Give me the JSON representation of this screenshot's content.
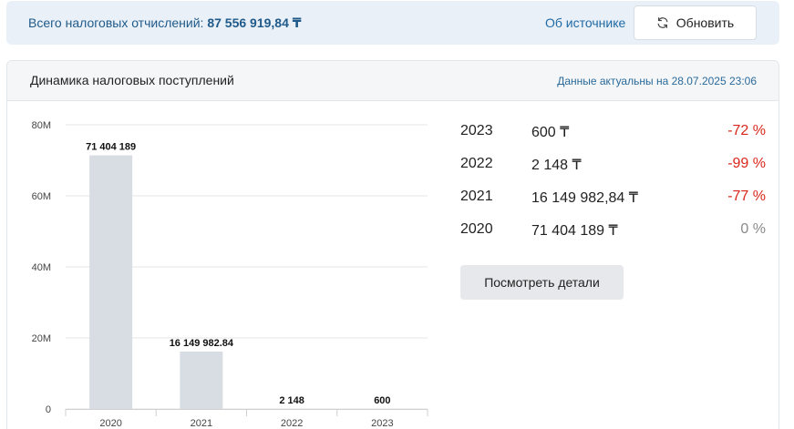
{
  "header": {
    "total_label": "Всего налоговых отчислений:",
    "total_value": "87 556 919,84 ₸",
    "source_link": "Об источнике",
    "refresh_label": "Обновить",
    "refresh_icon": "refresh-icon"
  },
  "panel": {
    "title": "Динамика налоговых поступлений",
    "updated": "Данные актуальны на 28.07.2025 23:06"
  },
  "stats": [
    {
      "year": "2023",
      "amount": "600 ₸",
      "change": "-72 %",
      "status": "negative"
    },
    {
      "year": "2022",
      "amount": "2 148 ₸",
      "change": "-99 %",
      "status": "negative"
    },
    {
      "year": "2021",
      "amount": "16 149 982,84 ₸",
      "change": "-77 %",
      "status": "negative"
    },
    {
      "year": "2020",
      "amount": "71 404 189 ₸",
      "change": "0 %",
      "status": "neutral"
    }
  ],
  "details_button": "Посмотреть детали",
  "colors": {
    "bar": "#d8dce3",
    "negative": "#d9261c",
    "neutral": "#8a8a8a",
    "accent": "#1f5a8a"
  },
  "chart_data": {
    "type": "bar",
    "categories": [
      "2020",
      "2021",
      "2022",
      "2023"
    ],
    "values": [
      71404189,
      16149982.84,
      2148,
      600
    ],
    "data_labels": [
      "71 404 189",
      "16 149 982.84",
      "2 148",
      "600"
    ],
    "y_ticks": [
      0,
      20000000,
      40000000,
      60000000,
      80000000
    ],
    "y_tick_labels": [
      "0",
      "20M",
      "40M",
      "60M",
      "80M"
    ],
    "ylim": [
      0,
      80000000
    ],
    "grid": true,
    "title": "",
    "xlabel": "",
    "ylabel": ""
  }
}
